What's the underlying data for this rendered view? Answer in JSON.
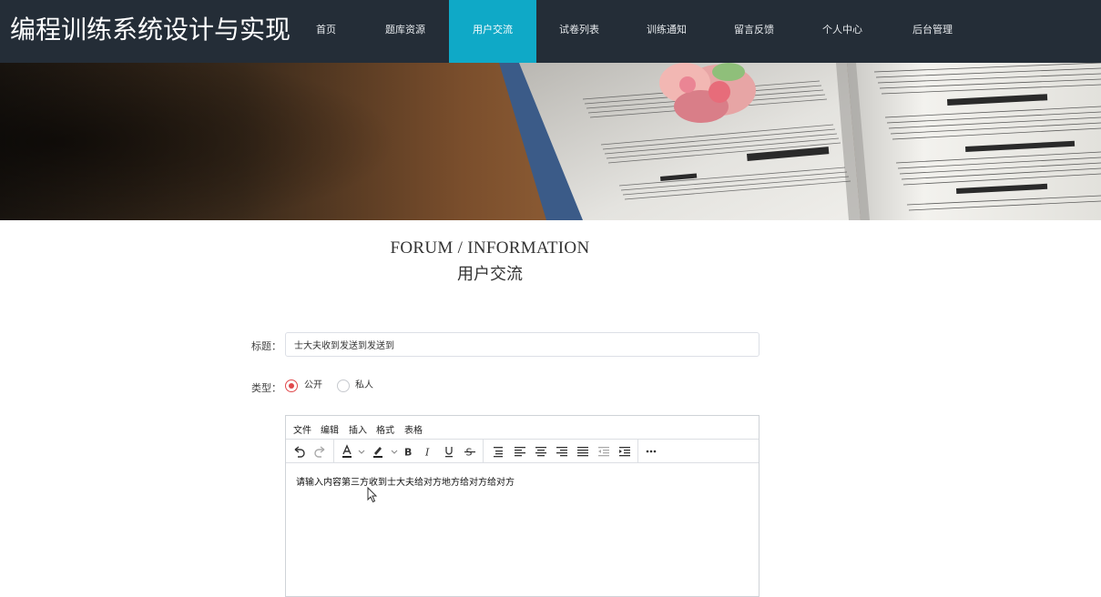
{
  "app": {
    "logo": "编程训练系统设计与实现"
  },
  "nav": {
    "items": [
      {
        "id": "home",
        "label": "首页"
      },
      {
        "id": "question-bank",
        "label": "题库资源"
      },
      {
        "id": "user-forum",
        "label": "用户交流",
        "active": true
      },
      {
        "id": "paper-list",
        "label": "试卷列表"
      },
      {
        "id": "training-notice",
        "label": "训练通知"
      },
      {
        "id": "feedback",
        "label": "留言反馈"
      },
      {
        "id": "personal-center",
        "label": "个人中心"
      },
      {
        "id": "admin",
        "label": "后台管理"
      }
    ],
    "active_color": "#0fa9c7",
    "bg_color": "#242d37"
  },
  "heading": {
    "en": "FORUM / INFORMATION",
    "cn": "用户交流"
  },
  "form": {
    "title_label": "标题：",
    "title_value": "士大夫收到发送到发送到",
    "type_label": "类型：",
    "type_options": [
      {
        "label": "公开",
        "checked": true
      },
      {
        "label": "私人",
        "checked": false
      }
    ]
  },
  "editor": {
    "menu": [
      "文件",
      "编辑",
      "插入",
      "格式",
      "表格"
    ],
    "toolbar_icons": [
      "undo-icon",
      "redo-icon",
      "text-color-icon",
      "highlight-icon",
      "bold-icon",
      "italic-icon",
      "underline-icon",
      "strikethrough-icon",
      "line-height-icon",
      "align-left-icon",
      "align-center-icon",
      "align-right-icon",
      "align-justify-icon",
      "outdent-icon",
      "indent-icon",
      "more-icon"
    ],
    "content": "请输入内容第三方收到士大夫给对方地方给对方给对方"
  },
  "colors": {
    "radio_checked": "#e0484b"
  }
}
